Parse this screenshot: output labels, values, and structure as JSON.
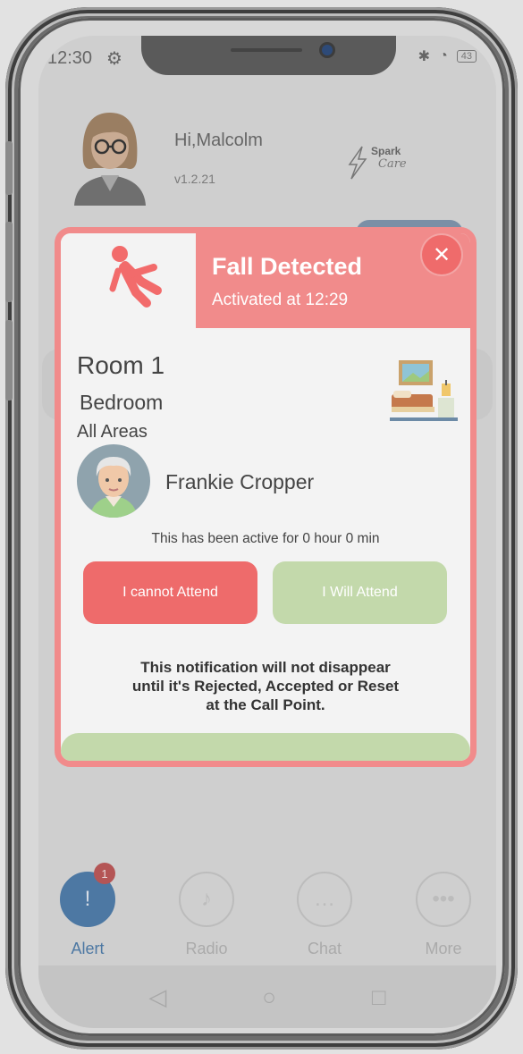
{
  "status_bar": {
    "time": "12:30",
    "battery": "43"
  },
  "header": {
    "greeting": "Hi,Malcolm",
    "version": "v1.2.21",
    "logo_top": "Spark",
    "logo_bottom": "Care"
  },
  "modal": {
    "title": "Fall Detected",
    "subtitle": "Activated at 12:29",
    "room": "Room 1",
    "room_type": "Bedroom",
    "area": "All Areas",
    "resident": "Frankie Cropper",
    "active_text": "This has been active for 0 hour 0 min",
    "cannot_label": "I cannot Attend",
    "will_label": "I Will Attend",
    "notice_line1": "This notification will not disappear",
    "notice_line2": "until it's Rejected, Accepted or Reset",
    "notice_line3": "at the Call Point."
  },
  "nav": {
    "items": [
      {
        "label": "Alert",
        "icon": "alert-icon",
        "badge": "1"
      },
      {
        "label": "Radio",
        "icon": "radio-icon"
      },
      {
        "label": "Chat",
        "icon": "chat-icon"
      },
      {
        "label": "More",
        "icon": "more-icon"
      }
    ]
  },
  "colors": {
    "accent": "#f18b8b",
    "danger": "#ee6b6b",
    "success": "#c3d9ab",
    "nav_active": "#4d78a3"
  }
}
